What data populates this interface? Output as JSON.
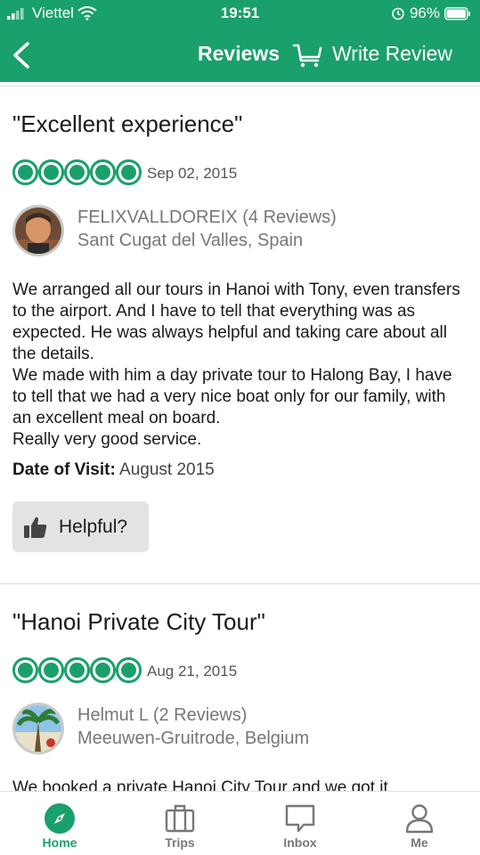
{
  "status_bar": {
    "carrier": "Viettel",
    "time": "19:51",
    "battery": "96%"
  },
  "nav": {
    "title": "Reviews",
    "write_review": "Write Review"
  },
  "reviews": [
    {
      "title": "\"Excellent experience\"",
      "rating": 5,
      "date": "Sep 02, 2015",
      "user_name": "FELIXVALLDOREIX (4 Reviews)",
      "user_location": "Sant Cugat del Valles, Spain",
      "body": [
        "We arranged all our tours in Hanoi with Tony, even transfers to the airport. And I have to tell that everything was as expected. He was always helpful and taking care about all the details.",
        "We made with him a day private tour to Halong Bay, I have to tell that we had a very nice boat only for our family, with an excellent meal on board.",
        "Really very good service."
      ],
      "visit_label": "Date of Visit:",
      "visit_value": "August 2015",
      "helpful_label": "Helpful?"
    },
    {
      "title": "\"Hanoi Private City Tour\"",
      "rating": 5,
      "date": "Aug 21, 2015",
      "user_name": "Helmut L (2 Reviews)",
      "user_location": "Meeuwen-Gruitrode, Belgium",
      "body": [
        "We booked a private Hanoi City Tour and we got it"
      ]
    }
  ],
  "tabs": [
    {
      "label": "Home",
      "icon": "compass-icon",
      "active": true
    },
    {
      "label": "Trips",
      "icon": "suitcase-icon",
      "active": false
    },
    {
      "label": "Inbox",
      "icon": "chat-bubble-icon",
      "active": false
    },
    {
      "label": "Me",
      "icon": "person-icon",
      "active": false
    }
  ],
  "colors": {
    "brand_green": "#1aa06b",
    "helpful_bg": "#e3e3e3"
  }
}
